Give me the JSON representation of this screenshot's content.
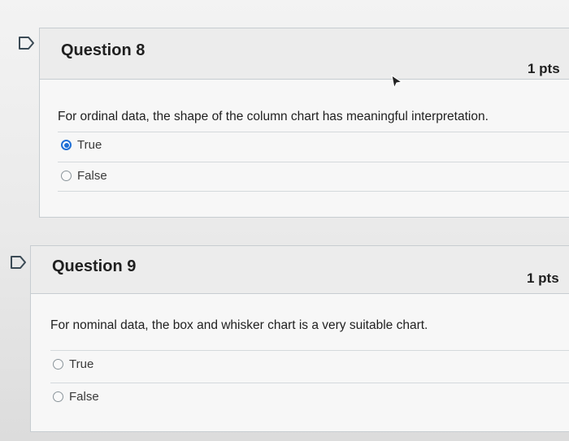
{
  "questions": [
    {
      "title": "Question 8",
      "points": "1 pts",
      "text": "For ordinal data, the shape of the column chart has meaningful interpretation.",
      "options": [
        {
          "label": "True",
          "selected": true
        },
        {
          "label": "False",
          "selected": false
        }
      ]
    },
    {
      "title": "Question 9",
      "points": "1 pts",
      "text": "For nominal data, the box and whisker chart is a very suitable chart.",
      "options": [
        {
          "label": "True",
          "selected": false
        },
        {
          "label": "False",
          "selected": false
        }
      ]
    }
  ],
  "colors": {
    "accent": "#1f6fd6",
    "header_bg": "#ececec",
    "border": "#c7cdd1"
  },
  "icons": {
    "flag": "flag-outline-icon",
    "cursor": "mouse-pointer-icon"
  }
}
